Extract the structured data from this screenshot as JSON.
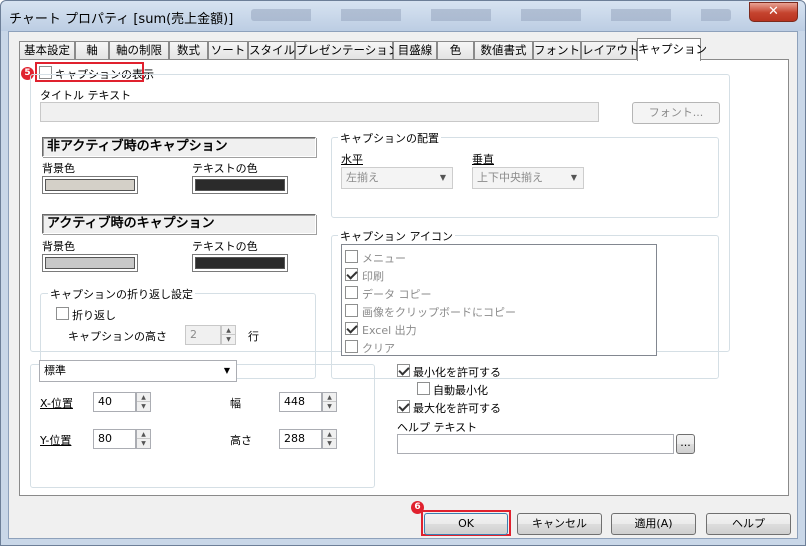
{
  "window": {
    "title": "チャート プロパティ [sum(売上金額)]",
    "close_label": "✕"
  },
  "tabs": [
    {
      "label": "基本設定"
    },
    {
      "label": "軸"
    },
    {
      "label": "軸の制限"
    },
    {
      "label": "数式"
    },
    {
      "label": "ソート"
    },
    {
      "label": "スタイル"
    },
    {
      "label": "プレゼンテーション"
    },
    {
      "label": "目盛線"
    },
    {
      "label": "色"
    },
    {
      "label": "数値書式"
    },
    {
      "label": "フォント"
    },
    {
      "label": "レイアウト"
    },
    {
      "label": "キャプション"
    }
  ],
  "caption": {
    "show_label": "キャプションの表示",
    "show_checked": false,
    "badge_show": "5",
    "title_text_label": "タイトル テキスト",
    "title_text_value": "",
    "font_button": "フォント..."
  },
  "inactive": {
    "header": "非アクティブ時のキャプション",
    "bg_label": "背景色",
    "text_label": "テキストの色",
    "bg_color": "#d4d0c8",
    "text_color": "#2b2b2b"
  },
  "active": {
    "header": "アクティブ時のキャプション",
    "bg_label": "背景色",
    "text_label": "テキストの色",
    "bg_color": "#c8c8c8",
    "text_color": "#2b2b2b"
  },
  "wrap": {
    "group_title": "キャプションの折り返し設定",
    "wrap_label": "折り返し",
    "height_label": "キャプションの高さ",
    "height_value": "2",
    "lines_label": "行"
  },
  "placement": {
    "group_title": "キャプションの配置",
    "horizontal_label": "水平",
    "vertical_label": "垂直",
    "horizontal_value": "左揃え",
    "vertical_value": "上下中央揃え"
  },
  "icons": {
    "group_title": "キャプション アイコン",
    "items": [
      {
        "label": "メニュー",
        "checked": false
      },
      {
        "label": "印刷",
        "checked": true
      },
      {
        "label": "データ コピー",
        "checked": false
      },
      {
        "label": "画像をクリップボードにコピー",
        "checked": false
      },
      {
        "label": "Excel 出力",
        "checked": true
      },
      {
        "label": "クリア",
        "checked": false
      }
    ]
  },
  "position": {
    "mode_value": "標準",
    "x_label": "X-位置",
    "x_value": "40",
    "y_label": "Y-位置",
    "y_value": "80",
    "width_label": "幅",
    "width_value": "448",
    "height_label": "高さ",
    "height_value": "288"
  },
  "options": {
    "allow_minimize": "最小化を許可する",
    "auto_minimize": "自動最小化",
    "allow_maximize": "最大化を許可する",
    "help_text_label": "ヘルプ テキスト",
    "help_text_value": "",
    "browse": "..."
  },
  "footer": {
    "ok": "OK",
    "cancel": "キャンセル",
    "apply": "適用(A)",
    "help": "ヘルプ",
    "badge_ok": "6"
  },
  "colors": {
    "highlight": "#e0212e"
  }
}
